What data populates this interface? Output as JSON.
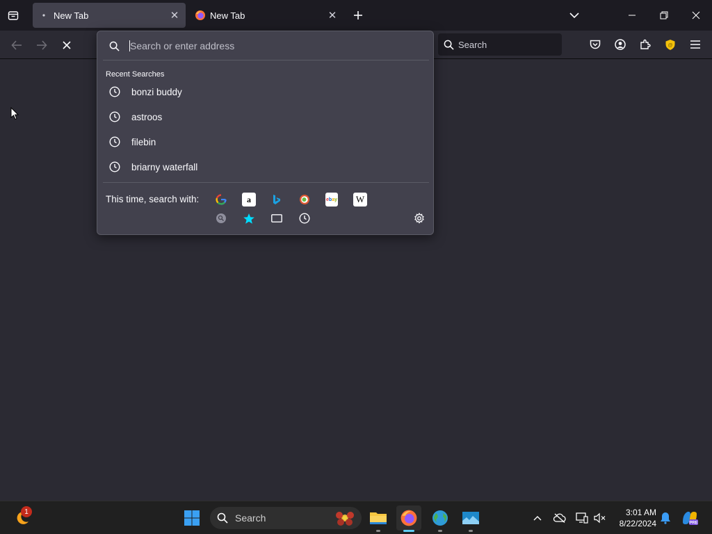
{
  "tabs": [
    {
      "title": "New Tab",
      "active": true
    },
    {
      "title": "New Tab",
      "active": false
    }
  ],
  "toolbar": {
    "search_placeholder": "Search"
  },
  "urlbar": {
    "placeholder": "Search or enter address",
    "recent_label": "Recent Searches",
    "recent": [
      "bonzi buddy",
      "astroos",
      "filebin",
      "briarny waterfall"
    ],
    "engines_label": "This time, search with:",
    "engines": [
      "google-icon",
      "amazon-icon",
      "bing-icon",
      "duckduckgo-icon",
      "ebay-icon",
      "wikipedia-icon",
      "search-engine-icon",
      "bookmarks-icon",
      "tabs-icon",
      "history-icon"
    ]
  },
  "taskbar": {
    "search_placeholder": "Search",
    "widget_badge": "1",
    "time": "3:01 AM",
    "date": "8/22/2024"
  },
  "colors": {
    "accent": "#00ddff",
    "panel": "#42414d",
    "background": "#2b2a33",
    "tabbar": "#1c1b22"
  }
}
